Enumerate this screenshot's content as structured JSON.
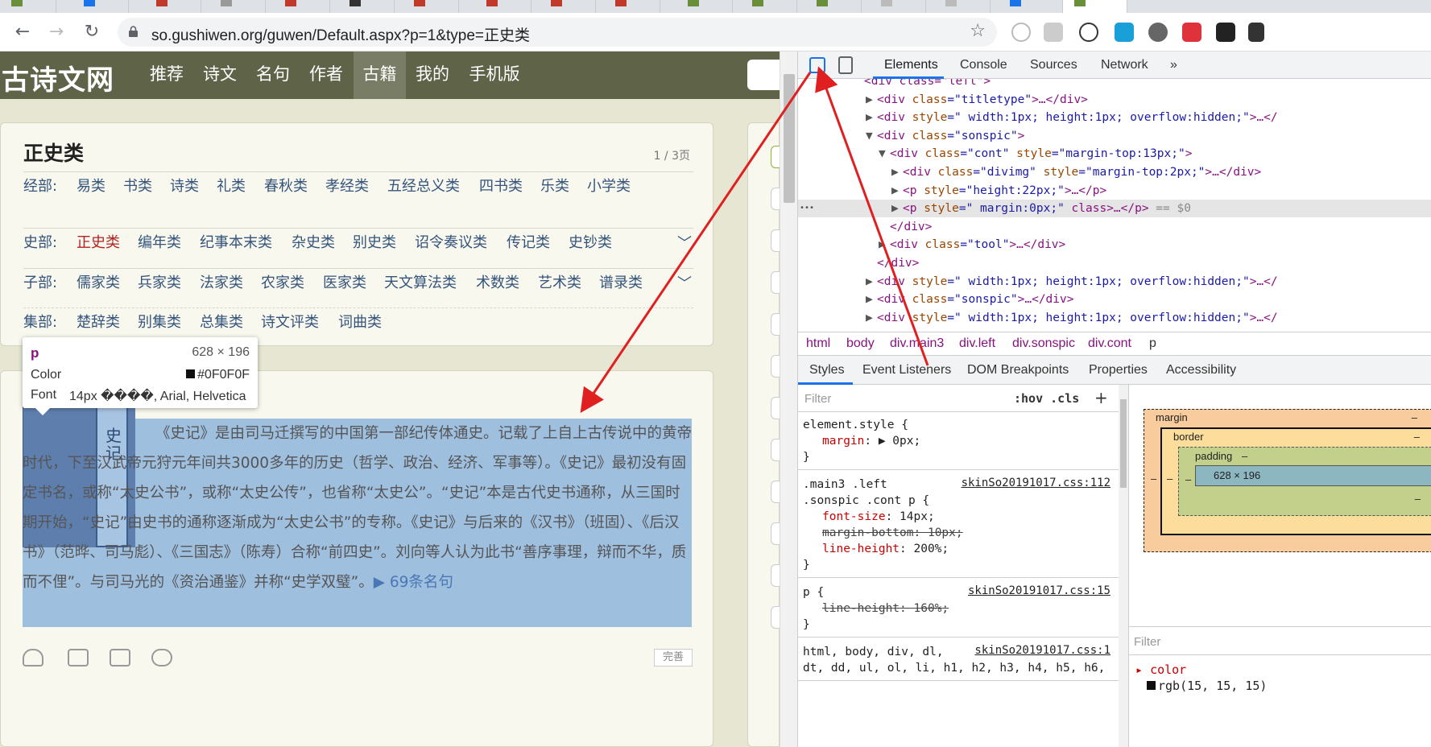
{
  "browser": {
    "url": "so.gushiwen.org/guwen/Default.aspx?p=1&type=正史类",
    "back_icon": "arrow-left-icon",
    "forward_icon": "arrow-right-icon",
    "reload_icon": "reload-icon"
  },
  "site": {
    "logo": "古诗文网",
    "nav": [
      "推荐",
      "诗文",
      "名句",
      "作者",
      "古籍",
      "我的",
      "手机版"
    ],
    "active_nav": "古籍"
  },
  "category_card": {
    "title": "正史类",
    "page_info": "1 / 3页",
    "rows": [
      {
        "label": "经部:",
        "items": [
          "易类",
          "书类",
          "诗类",
          "礼类",
          "春秋类",
          "孝经类",
          "五经总义类",
          "四书类",
          "乐类",
          "小学类"
        ],
        "expandable": false
      },
      {
        "label": "史部:",
        "items": [
          "正史类",
          "编年类",
          "纪事本末类",
          "杂史类",
          "别史类",
          "诏令奏议类",
          "传记类",
          "史钞类"
        ],
        "current": "正史类",
        "expandable": true
      },
      {
        "label": "子部:",
        "items": [
          "儒家类",
          "兵家类",
          "法家类",
          "农家类",
          "医家类",
          "天文算法类",
          "术数类",
          "艺术类",
          "谱录类"
        ],
        "expandable": true
      },
      {
        "label": "集部:",
        "items": [
          "楚辞类",
          "别集类",
          "总集类",
          "诗文评类",
          "词曲类"
        ],
        "expandable": false
      }
    ]
  },
  "book": {
    "cover_text": "史记",
    "description": "《史记》是由司马迁撰写的中国第一部纪传体通史。记载了上自上古传说中的黄帝时代，下至汉武帝元狩元年间共3000多年的历史（哲学、政治、经济、军事等）。《史记》最初没有固定书名，或称“太史公书”，或称“太史公传”，也省称“太史公”。“史记”本是古代史书通称，从三国时期开始，“史记”由史书的通称逐渐成为“太史公书”的专称。《史记》与后来的《汉书》（班固）、《后汉书》（范晔、司马彪）、《三国志》（陈寿）合称“前四史”。刘向等人认为此书“善序事理，辩而不华，质而不俚”。与司马光的《资治通鉴》并称“史学双璧”。",
    "more_link": "▶ 69条名句",
    "corner_label": "完善"
  },
  "tooltip": {
    "tag": "p",
    "size": "628 × 196",
    "color_label": "Color",
    "color_value": "#0F0F0F",
    "font_label": "Font",
    "font_value": "14px ����, Arial, Helvetica"
  },
  "devtools": {
    "tabs": [
      "Elements",
      "Console",
      "Sources",
      "Network",
      "»"
    ],
    "active_tab": "Elements",
    "dom_lines": [
      {
        "indent": 0,
        "tri": "",
        "html": "<div class=\"left\">"
      },
      {
        "indent": 1,
        "tri": "▶",
        "tag": "div",
        "attrs": [
          [
            "class",
            "titletype"
          ]
        ],
        "tail": ">…</div>"
      },
      {
        "indent": 1,
        "tri": "▶",
        "tag": "div",
        "attrs": [
          [
            "style",
            " width:1px; height:1px; overflow:hidden;"
          ]
        ],
        "tail": ">…</"
      },
      {
        "indent": 1,
        "tri": "▼",
        "tag": "div",
        "attrs": [
          [
            "class",
            "sonspic"
          ]
        ],
        "tail": ">"
      },
      {
        "indent": 2,
        "tri": "▼",
        "tag": "div",
        "attrs": [
          [
            "class",
            "cont"
          ],
          [
            "style",
            "margin-top:13px;"
          ]
        ],
        "tail": ">"
      },
      {
        "indent": 3,
        "tri": "▶",
        "tag": "div",
        "attrs": [
          [
            "class",
            "divimg"
          ],
          [
            "style",
            "margin-top:2px;"
          ]
        ],
        "tail": ">…</div>"
      },
      {
        "indent": 3,
        "tri": "▶",
        "tag": "p",
        "attrs": [
          [
            "style",
            "height:22px;"
          ]
        ],
        "tail": ">…</p>"
      },
      {
        "indent": 3,
        "tri": "▶",
        "tag": "p",
        "attrs": [
          [
            "style",
            " margin:0px;"
          ]
        ],
        "tail": " class>…</p>",
        "selected": true,
        "eq": "== $0"
      },
      {
        "indent": 2,
        "tri": "",
        "close": "</div>"
      },
      {
        "indent": 2,
        "tri": "▶",
        "tag": "div",
        "attrs": [
          [
            "class",
            "tool"
          ]
        ],
        "tail": ">…</div>"
      },
      {
        "indent": 1,
        "tri": "",
        "close": "</div>"
      },
      {
        "indent": 1,
        "tri": "▶",
        "tag": "div",
        "attrs": [
          [
            "style",
            " width:1px; height:1px; overflow:hidden;"
          ]
        ],
        "tail": ">…</"
      },
      {
        "indent": 1,
        "tri": "▶",
        "tag": "div",
        "attrs": [
          [
            "class",
            "sonspic"
          ]
        ],
        "tail": ">…</div>"
      },
      {
        "indent": 1,
        "tri": "▶",
        "tag": "div",
        "attrs": [
          [
            "style",
            " width:1px; height:1px; overflow:hidden;"
          ]
        ],
        "tail": ">…</"
      }
    ],
    "breadcrumbs": [
      "html",
      "body",
      "div.main3",
      "div.left",
      "div.sonspic",
      "div.cont",
      "p"
    ],
    "subtabs": [
      "Styles",
      "Event Listeners",
      "DOM Breakpoints",
      "Properties",
      "Accessibility"
    ],
    "filter_placeholder": "Filter",
    "hov_cls": ":hov  .cls",
    "style_rules": [
      {
        "selector": "element.style {",
        "source": "",
        "props": [
          {
            "name": "margin",
            "value": "▶ 0px;",
            "struck": false
          }
        ]
      },
      {
        "selector": ".main3 .left",
        "selector2": ".sonspic .cont p {",
        "source": "skinSo20191017.css:112",
        "props": [
          {
            "name": "font-size",
            "value": "14px;",
            "struck": false
          },
          {
            "name": "margin-bottom",
            "value": "10px;",
            "struck": true
          },
          {
            "name": "line-height",
            "value": "200%;",
            "struck": false
          }
        ]
      },
      {
        "selector": "p {",
        "source": "skinSo20191017.css:15",
        "props": [
          {
            "name": "line-height",
            "value": "160%;",
            "struck": true
          }
        ]
      },
      {
        "selector": "html, body, div, dl,",
        "selector2": "dt, dd, ul, ol, li, h1, h2, h3, h4, h5, h6,",
        "source": "skinSo20191017.css:1",
        "props": []
      }
    ],
    "box_model": {
      "margin": "margin",
      "border": "border",
      "padding": "padding",
      "content": "628 × 196",
      "dash": "–"
    },
    "computed_filter": "Filter",
    "computed_prop": "color",
    "computed_value": "rgb(15, 15, 15)"
  },
  "colors": {
    "header": "#5f6448",
    "page_bg": "#e6e6d3",
    "link": "#34547c",
    "highlight": "#9fbfdf",
    "arrow": "#e02020"
  }
}
